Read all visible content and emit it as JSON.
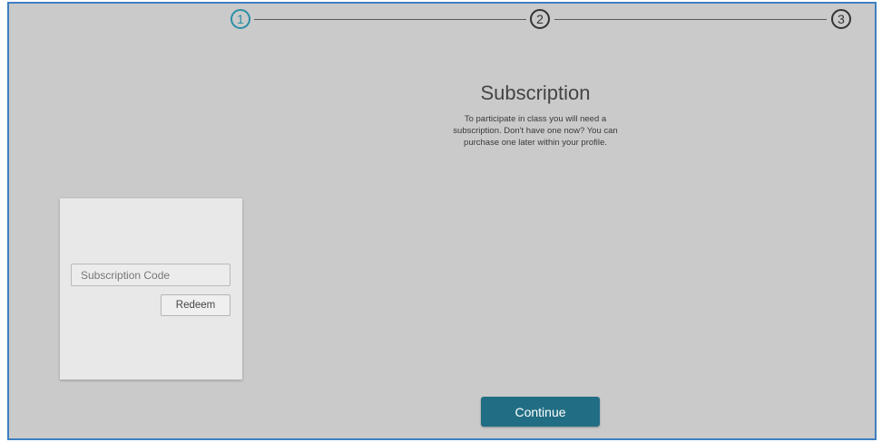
{
  "stepper": {
    "steps": [
      {
        "label": "1",
        "state": "active"
      },
      {
        "label": "2",
        "state": "inactive"
      },
      {
        "label": "3",
        "state": "inactive"
      }
    ]
  },
  "subscription": {
    "title": "Subscription",
    "description": "To participate in class you will need a subscription. Don't have one now? You can purchase one later within your profile."
  },
  "redeem_card": {
    "code_placeholder": "Subscription Code",
    "redeem_label": "Redeem"
  },
  "footer": {
    "continue_label": "Continue"
  },
  "colors": {
    "accent": "#216e84",
    "active_step": "#2a8fa6",
    "frame_border": "#3d7fc0",
    "background": "#cacaca"
  }
}
